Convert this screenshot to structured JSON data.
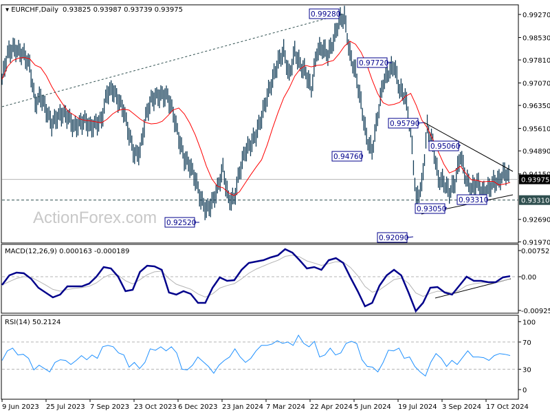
{
  "header": {
    "symbol": "EURCHF,Daily",
    "ohlc": "0.93825 0.93987 0.93739 0.93975"
  },
  "watermark": "ActionForex.com",
  "colors": {
    "bars": "#0f3a55",
    "ma": "#ff0000",
    "macd": "#00008b",
    "signal": "#b4b4b4",
    "rsi": "#1e90ff",
    "annotation": "#00008b"
  },
  "chart_data": [
    {
      "type": "line",
      "title": "EURCHF,Daily",
      "price_axis_ticks": [
        "0.99270",
        "0.98530",
        "0.97810",
        "0.97070",
        "0.96350",
        "0.95610",
        "0.94890",
        "0.94150",
        "0.92690",
        "0.91970"
      ],
      "ylim": [
        0.9197,
        0.9927
      ],
      "current_price": "0.93975",
      "support_level": "0.93310",
      "x_ticks": [
        "9 Jun 2023",
        "25 Jul 2023",
        "7 Sep 2023",
        "23 Oct 2023",
        "6 Dec 2023",
        "23 Jan 2024",
        "7 Mar 2024",
        "22 Apr 2024",
        "5 Jun 2024",
        "19 Jul 2024",
        "3 Sep 2024",
        "17 Oct 2024"
      ],
      "closes": [
        0.9719,
        0.9801,
        0.9819,
        0.9808,
        0.9797,
        0.9763,
        0.9642,
        0.9664,
        0.962,
        0.9576,
        0.9598,
        0.9609,
        0.9598,
        0.9565,
        0.9576,
        0.9587,
        0.9565,
        0.9576,
        0.9587,
        0.9675,
        0.9686,
        0.9653,
        0.962,
        0.9542,
        0.9476,
        0.9487,
        0.9598,
        0.9653,
        0.9664,
        0.9668,
        0.9664,
        0.9609,
        0.9531,
        0.9465,
        0.9443,
        0.9399,
        0.9333,
        0.9299,
        0.9321,
        0.9366,
        0.9432,
        0.9333,
        0.9333,
        0.9421,
        0.9487,
        0.9509,
        0.9542,
        0.9598,
        0.9664,
        0.9719,
        0.9775,
        0.9808,
        0.973,
        0.9808,
        0.9763,
        0.9741,
        0.9686,
        0.9808,
        0.9819,
        0.9797,
        0.9841,
        0.9907,
        0.9918,
        0.9797,
        0.9741,
        0.9642,
        0.9531,
        0.9487,
        0.9598,
        0.9708,
        0.9741,
        0.9763,
        0.9686,
        0.9664,
        0.9554,
        0.9333,
        0.9377,
        0.9565,
        0.9509,
        0.9399,
        0.9388,
        0.9355,
        0.9388,
        0.9476,
        0.9399,
        0.9366,
        0.9388,
        0.9355,
        0.9366,
        0.9388,
        0.9394,
        0.9421,
        0.9399
      ],
      "annotations": [
        "0.99280",
        "0.97720",
        "0.94760",
        "0.95790",
        "0.95060",
        "0.93050",
        "0.93310",
        "0.92520",
        "0.92090"
      ]
    },
    {
      "type": "line",
      "title": "MACD(12,26,9) 0.000163 -0.000189",
      "y_ticks": [
        "0.007526",
        "0.00",
        "-0.009252"
      ],
      "ylim": [
        -0.009252,
        0.007526
      ],
      "macd": [
        -0.00234,
        0.00039,
        0.00117,
        0.00098,
        -0.00059,
        -0.00312,
        -0.00449,
        -0.00585,
        -0.00507,
        -0.00273,
        -0.00273,
        -0.00273,
        -0.00195,
        0,
        0.00273,
        0.00234,
        0,
        -0.0041,
        -0.00371,
        0.00137,
        0.00312,
        0.00293,
        0.00195,
        -0.00449,
        -0.00507,
        -0.0041,
        -0.00488,
        -0.00741,
        -0.00741,
        -0.00312,
        -0.0002,
        -0.00117,
        -0.00098,
        0.00195,
        0.0039,
        0.00429,
        0.00468,
        0.00546,
        0.00605,
        0.0078,
        0.00683,
        0.00468,
        0.00234,
        0.00273,
        0.00195,
        0.00468,
        0.00527,
        0.0039,
        -0.0002,
        -0.0041,
        -0.00839,
        -0.00741,
        -0.00254,
        0.00039,
        0.00195,
        0.00039,
        -0.00449,
        -0.00975,
        -0.00741,
        -0.00312,
        -0.00293,
        -0.00449,
        -0.00507,
        -0.00254,
        0,
        -0.00117,
        -0.00117,
        -0.00156,
        -0.00156,
        -0.0002,
        0.000163
      ]
    },
    {
      "type": "line",
      "title": "RSI(14) 50.2124",
      "y_ticks": [
        "100",
        "70",
        "30",
        "0"
      ],
      "ylim": [
        0,
        100
      ],
      "levels": [
        70,
        30
      ],
      "rsi": [
        43,
        57,
        61,
        51,
        52,
        46,
        29,
        36,
        31,
        26,
        40,
        44,
        43,
        37,
        43,
        50,
        44,
        51,
        46,
        63,
        65,
        63,
        54,
        51,
        33,
        40,
        31,
        40,
        60,
        58,
        63,
        57,
        63,
        54,
        30,
        29,
        36,
        48,
        41,
        34,
        24,
        36,
        43,
        48,
        60,
        48,
        40,
        46,
        57,
        65,
        65,
        67,
        72,
        68,
        70,
        65,
        80,
        68,
        63,
        71,
        48,
        51,
        61,
        51,
        54,
        68,
        71,
        68,
        44,
        34,
        33,
        26,
        40,
        58,
        57,
        61,
        46,
        48,
        34,
        26,
        20,
        40,
        53,
        46,
        34,
        43,
        37,
        47,
        57,
        48,
        48,
        47,
        43,
        50,
        53,
        52,
        50.2
      ]
    }
  ]
}
